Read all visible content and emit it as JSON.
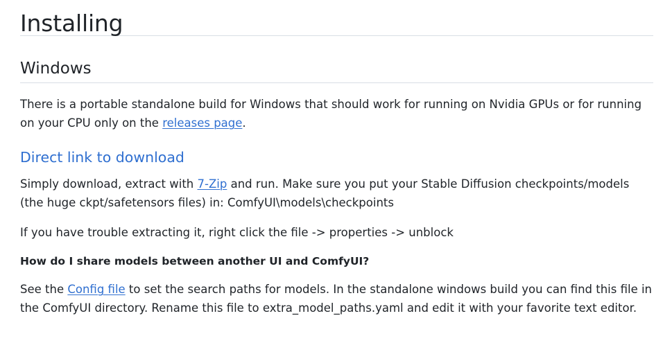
{
  "heading": "Installing",
  "windows": {
    "title": "Windows",
    "para1_before": "There is a portable standalone build for Windows that should work for running on Nvidia GPUs or for running on your CPU only on the ",
    "para1_link": "releases page",
    "para1_after": "."
  },
  "direct": {
    "title": "Direct link to download",
    "para1_before": "Simply download, extract with ",
    "para1_link": "7-Zip",
    "para1_after": " and run. Make sure you put your Stable Diffusion checkpoints/models (the huge ckpt/safetensors files) in: ComfyUI\\models\\checkpoints",
    "para2": "If you have trouble extracting it, right click the file -> properties -> unblock"
  },
  "share": {
    "title": "How do I share models between another UI and ComfyUI?",
    "para_before": "See the ",
    "para_link": "Config file",
    "para_after": " to set the search paths for models. In the standalone windows build you can find this file in the ComfyUI directory. Rename this file to extra_model_paths.yaml and edit it with your favorite text editor."
  },
  "colors": {
    "text": "#1f2328",
    "link": "#2f6fd0",
    "divider": "#d8dee4"
  }
}
